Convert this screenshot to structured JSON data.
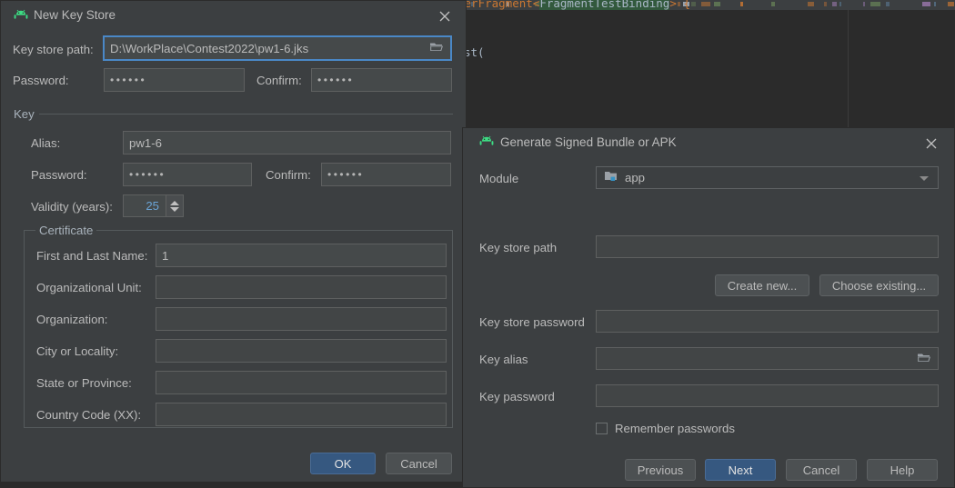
{
  "background": {
    "editor_code_top": "serFragment<FragmentTestBinding> {",
    "editor_code_highlight": "FragmentTestBinding",
    "editor_code_second": "st("
  },
  "new_key_store_dialog": {
    "title": "New Key Store",
    "title_icon": "android-icon",
    "close_icon": "close-icon",
    "keystore_path": {
      "label": "Key store path:",
      "value": "D:\\WorkPlace\\Contest2022\\pw1-6.jks",
      "browse_icon": "folder-icon"
    },
    "password": {
      "label": "Password:",
      "value": "••••••"
    },
    "password_confirm": {
      "label": "Confirm:",
      "value": "••••••"
    },
    "key_group_label": "Key",
    "alias": {
      "label": "Alias:",
      "value": "pw1-6"
    },
    "key_password": {
      "label": "Password:",
      "value": "••••••"
    },
    "key_password_confirm": {
      "label": "Confirm:",
      "value": "••••••"
    },
    "validity": {
      "label": "Validity (years):",
      "value": "25"
    },
    "certificate": {
      "legend": "Certificate",
      "fields": [
        {
          "label": "First and Last Name:",
          "value": "1"
        },
        {
          "label": "Organizational Unit:",
          "value": ""
        },
        {
          "label": "Organization:",
          "value": ""
        },
        {
          "label": "City or Locality:",
          "value": ""
        },
        {
          "label": "State or Province:",
          "value": ""
        },
        {
          "label": "Country Code (XX):",
          "value": ""
        }
      ]
    },
    "buttons": {
      "ok": "OK",
      "cancel": "Cancel"
    }
  },
  "generate_signed_dialog": {
    "title": "Generate Signed Bundle or APK",
    "title_icon": "android-icon",
    "close_icon": "close-icon",
    "module": {
      "label": "Module",
      "value": "app",
      "icon": "module-folder-icon"
    },
    "keystore_path": {
      "label": "Key store path",
      "value": ""
    },
    "create_new_button": "Create new...",
    "choose_existing_button": "Choose existing...",
    "keystore_password": {
      "label": "Key store password",
      "value": ""
    },
    "key_alias": {
      "label": "Key alias",
      "value": "",
      "browse_icon": "folder-icon"
    },
    "key_password": {
      "label": "Key password",
      "value": ""
    },
    "remember_passwords": {
      "label": "Remember passwords",
      "checked": false
    },
    "buttons": {
      "previous": "Previous",
      "next": "Next",
      "cancel": "Cancel",
      "help": "Help"
    }
  },
  "colors": {
    "dialog_bg": "#3c3f41",
    "field_bg": "#45494a",
    "accent_blue": "#365880",
    "focus_blue": "#4a88c7",
    "android_green": "#3ddc84",
    "text": "#bbbbbb"
  }
}
